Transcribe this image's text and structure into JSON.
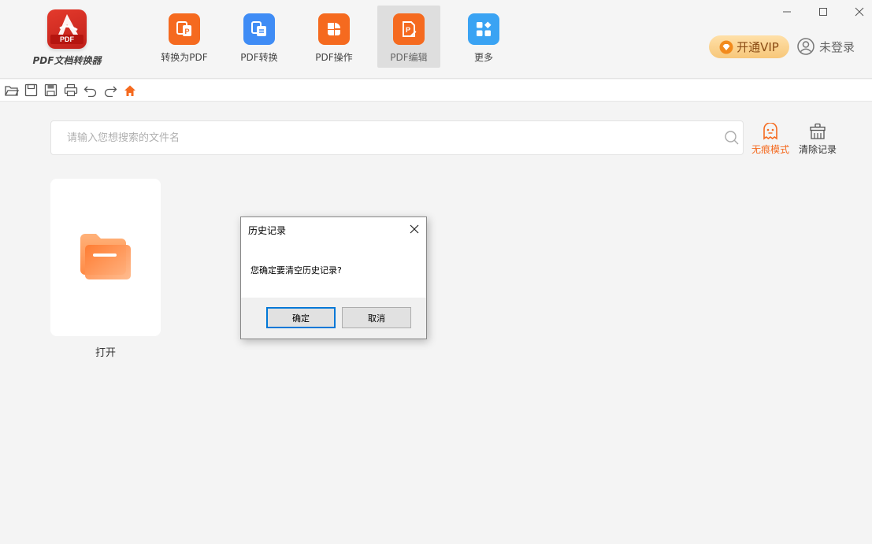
{
  "app": {
    "logo_text": "PDF",
    "name": "PDF文档转换器"
  },
  "ribbon": [
    {
      "label": "转换为PDF",
      "color": "#f56a1f"
    },
    {
      "label": "PDF转换",
      "color": "#3f8cf5"
    },
    {
      "label": "PDF操作",
      "color": "#f56a1f"
    },
    {
      "label": "PDF编辑",
      "color": "#f56a1f",
      "active": true
    },
    {
      "label": "更多",
      "color": "#3aa3f3"
    }
  ],
  "header": {
    "vip_label": "开通VIP",
    "login_label": "未登录"
  },
  "search": {
    "placeholder": "请输入您想搜索的文件名",
    "value": ""
  },
  "tools": {
    "incognito_label": "无痕模式",
    "incognito_color": "#f56a1f",
    "clear_label": "清除记录"
  },
  "open_card": {
    "label": "打开"
  },
  "dialog": {
    "title": "历史记录",
    "message": "您确定要清空历史记录?",
    "ok_label": "确定",
    "cancel_label": "取消"
  }
}
